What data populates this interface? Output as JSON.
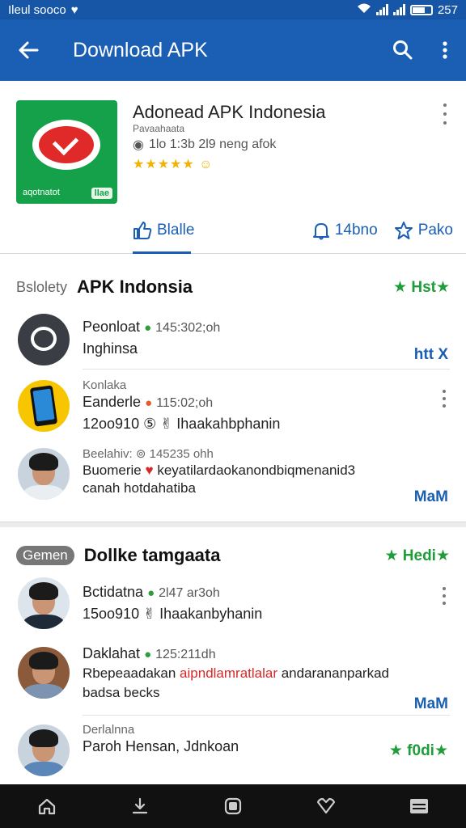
{
  "status_bar": {
    "carrier": "Ileul sooco",
    "time": "257"
  },
  "app_bar": {
    "title": "Download APK"
  },
  "app": {
    "name": "Adonead APK Indonesia",
    "sub": "Pavaahaata",
    "meta": "1lo 1:3b 2l9 neng afok",
    "stars": "★★★★★",
    "icon_text": "aqotnatot",
    "icon_badge": "llae",
    "tabs": [
      {
        "label": "Blalle",
        "icon": "thumbs-up-icon"
      },
      {
        "label": "14bno",
        "icon": "bell-icon"
      },
      {
        "label": "Pako",
        "icon": "star-outline-icon"
      }
    ]
  },
  "section1": {
    "prefix": "Bslolety",
    "title": "APK Indonsia",
    "tag": "★ Hst★",
    "rows": [
      {
        "avatar": "chat-avatar",
        "kicker": "",
        "name": "Peonloat",
        "meta": "145:302;oh",
        "line2": "Inghinsa",
        "action": "htt X"
      },
      {
        "avatar": "phone-avatar",
        "kicker": "Konlaka",
        "name": "Eanderle",
        "meta": "115:02;oh",
        "line2": "12oo910 ⑤ ✌ Ihaakahbphanin",
        "action": ""
      },
      {
        "avatar": "face-avatar",
        "kicker": "Beelahiv: ⊚ 145235 ohh",
        "name": "Buomerie",
        "meta": "keyatilardaokanondbiqmenanid3",
        "line2": "canah hotdahatiba",
        "action": "MaM"
      }
    ]
  },
  "section2": {
    "prefix": "Gemen",
    "title": "Dollke tamgaata",
    "tag": "★ Hedi★",
    "rows": [
      {
        "avatar": "face-avatar-dark",
        "kicker": "",
        "name": "Bctidatna",
        "meta": "2l47 ar3oh",
        "line2": "15oo910 ✌ Ihaakanbyhanin",
        "action": ""
      },
      {
        "avatar": "face-avatar-shop",
        "kicker": "",
        "name": "Daklahat",
        "meta": "125:211dh",
        "line2_a": "Rbepeaadakan ",
        "line2_red": "aipndlamratlalar",
        "line2_b": " andarananparkad",
        "line3": "badsa becks",
        "action": "MaM"
      },
      {
        "avatar": "face-avatar-blue",
        "kicker": "Derlalnna",
        "name": "Paroh Hensan, Jdnkoan",
        "meta": "",
        "line2": "",
        "action": "★ f0di★"
      }
    ]
  },
  "nav": [
    "home-icon",
    "download-icon",
    "square-icon",
    "heart-icon",
    "list-icon"
  ],
  "colors": {
    "primary": "#1a5fb4",
    "accent_green": "#1f9d3a",
    "star": "#f2b300"
  }
}
